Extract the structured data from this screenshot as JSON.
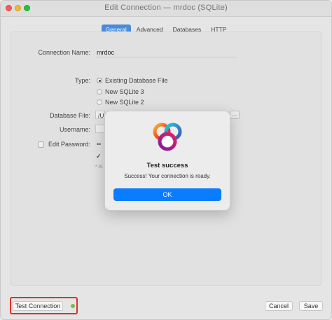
{
  "window": {
    "title": "Edit Connection — mrdoc (SQLite)"
  },
  "tabs": [
    "General",
    "Advanced",
    "Databases",
    "HTTP"
  ],
  "form": {
    "connection_name_label": "Connection Name:",
    "connection_name_value": "mrdoc",
    "type_label": "Type:",
    "type_options": [
      "Existing Database File",
      "New SQLite 3",
      "New SQLite 2"
    ],
    "type_selected": "Existing Database File",
    "database_file_label": "Database File:",
    "database_file_partial": "/U",
    "browse_button": "...",
    "username_label": "Username:",
    "edit_password_label": "Edit Password:",
    "password_partial": "••",
    "hidden_check_partial": "✓",
    "hidden_note_partial": "* Al"
  },
  "dialog": {
    "title": "Test success",
    "message": "Success! Your connection is ready.",
    "ok_label": "OK",
    "logo_icon": "navicat-logo-icon"
  },
  "footer": {
    "test_connection_label": "Test Connection",
    "cancel_label": "Cancel",
    "save_label": "Save",
    "status_color": "#6cc04a",
    "highlight_color": "#e0302a"
  }
}
